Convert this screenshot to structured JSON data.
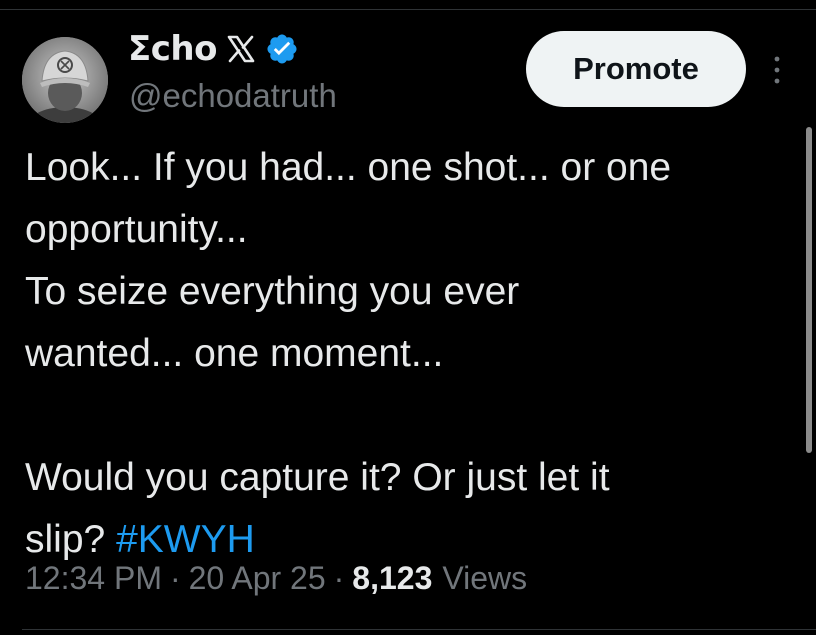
{
  "author": {
    "name": "Ʃcho",
    "platform_mark": "X",
    "handle": "@echodatruth",
    "avatar_icon": "avatar-photo-cap-icon"
  },
  "actions": {
    "promote_label": "Promote",
    "more_icon": "more-vertical-icon"
  },
  "tweet": {
    "lines": [
      "Look... If you had... one shot... or one",
      "opportunity...",
      "To seize everything you ever",
      "wanted... one moment...",
      "",
      "Would you capture it? Or just let it"
    ],
    "last_line_text": "slip?",
    "hashtag": "#KWYH"
  },
  "meta": {
    "time": "12:34 PM",
    "separator": "·",
    "date": "20 Apr 25",
    "views_count": "8,123",
    "views_label": "Views"
  },
  "colors": {
    "background": "#000000",
    "text_primary": "#e7e9ea",
    "text_secondary": "#71767b",
    "accent_blue": "#1d9bf0",
    "button_bg": "#eff3f4",
    "divider": "#2f3336"
  }
}
